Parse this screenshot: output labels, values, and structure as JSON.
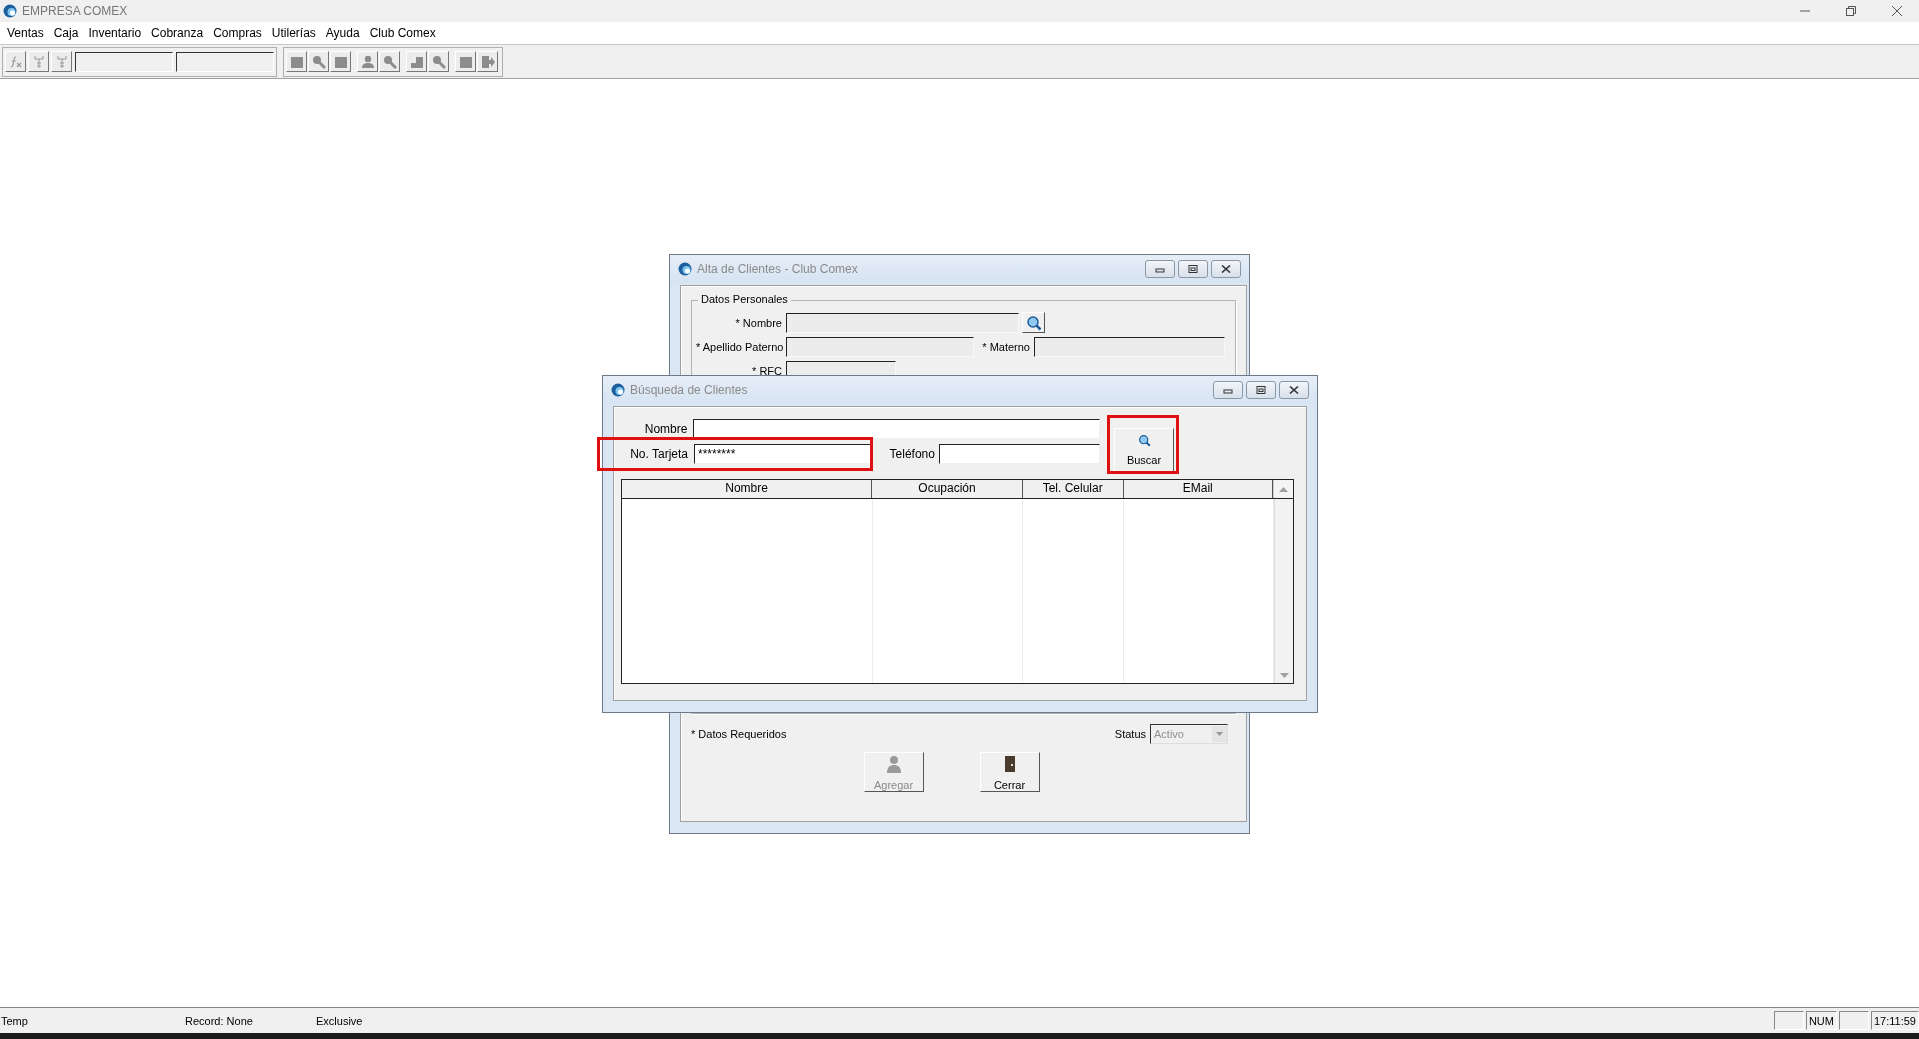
{
  "app": {
    "title": "EMPRESA COMEX"
  },
  "menu": [
    {
      "label": "Ventas"
    },
    {
      "label": "Caja"
    },
    {
      "label": "Inventario"
    },
    {
      "label": "Cobranza"
    },
    {
      "label": "Compras"
    },
    {
      "label": "Utilerías"
    },
    {
      "label": "Ayuda"
    },
    {
      "label": "Club Comex"
    }
  ],
  "alta": {
    "title": "Alta de Clientes - Club Comex",
    "group": "Datos Personales",
    "nombre": {
      "label": "* Nombre"
    },
    "paterno": {
      "label": "* Apellido Paterno"
    },
    "materno": {
      "label": "* Materno"
    },
    "rfc": {
      "label": "* RFC"
    },
    "required_note": "* Datos Requeridos",
    "status": {
      "label": "Status",
      "value": "Activo",
      "disabled": true
    },
    "buttons": [
      {
        "label": "Agregar",
        "disabled": true,
        "kind": "person"
      },
      {
        "label": "Cerrar",
        "disabled": false,
        "kind": "door"
      }
    ]
  },
  "busqueda": {
    "title": "Búsqueda de Clientes",
    "nombre": {
      "label": "Nombre"
    },
    "tarjeta": {
      "label": "No. Tarjeta",
      "value": "********",
      "highlighted": true
    },
    "telefono": {
      "label": "Teléfono"
    },
    "buscar": {
      "label": "Buscar",
      "highlighted": true
    },
    "columns": [
      "Nombre",
      "Ocupación",
      "Tel. Celular",
      "EMail"
    ]
  },
  "status_bar": {
    "panels": [
      "Temp",
      "Record: None",
      "Exclusive"
    ],
    "indicators": [
      "NUM"
    ],
    "clock": "17:11:59"
  }
}
